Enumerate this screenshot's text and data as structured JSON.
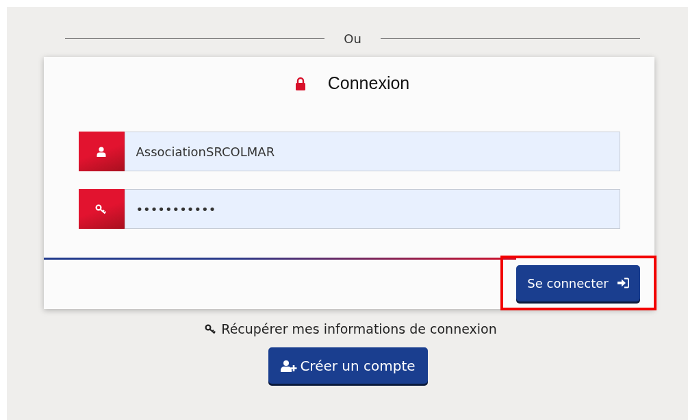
{
  "divider": {
    "text": "Ou"
  },
  "login": {
    "title": "Connexion",
    "fields": [
      {
        "kind": "user",
        "value": "AssociationSRCOLMAR"
      },
      {
        "kind": "password",
        "value": "•••••••••••"
      }
    ],
    "submit": {
      "label": "Se connecter",
      "highlighted": true
    }
  },
  "recover_link": "Récupérer mes informations de connexion",
  "create_account_button": "Créer un compte"
}
